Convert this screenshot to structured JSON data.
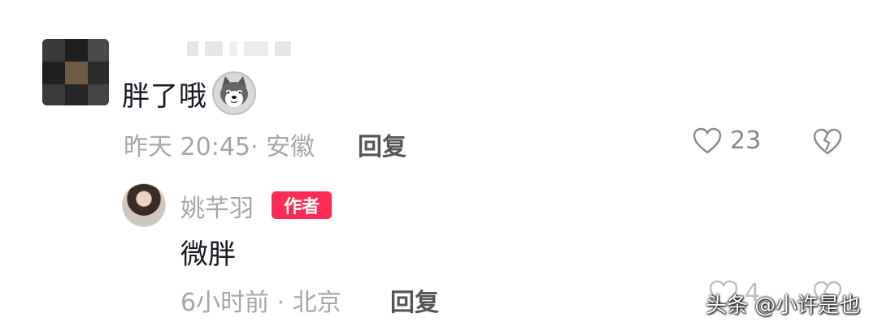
{
  "comment": {
    "text": "胖了哦",
    "emoji": "husky-emoji",
    "time": "昨天 20:45",
    "location": "安徽",
    "reply_label": "回复",
    "like_count": "23"
  },
  "reply": {
    "author": "姚芊羽",
    "badge": "作者",
    "text": "微胖",
    "time": "6小时前",
    "location": "北京",
    "reply_label": "回复",
    "like_count": "4"
  },
  "watermark": "头条 @小许是也",
  "colors": {
    "badge_bg": "#fe2c55",
    "meta": "#a6a6a6"
  }
}
